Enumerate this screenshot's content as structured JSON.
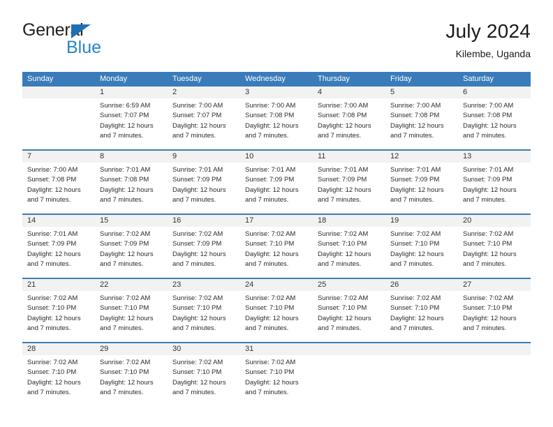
{
  "brand": {
    "name_top": "General",
    "name_bottom": "Blue",
    "triangle_color": "#1f6fb5",
    "top_color": "#231f20",
    "bottom_color": "#2585c7"
  },
  "header": {
    "title": "July 2024",
    "subtitle": "Kilembe, Uganda"
  },
  "theme": {
    "header_blue": "#3a7cba",
    "day_band_gray": "#f2f2f2",
    "text": "#2b2b2b"
  },
  "weekdays": [
    "Sunday",
    "Monday",
    "Tuesday",
    "Wednesday",
    "Thursday",
    "Friday",
    "Saturday"
  ],
  "weeks": [
    [
      {
        "day": "",
        "lines": []
      },
      {
        "day": "1",
        "lines": [
          "Sunrise: 6:59 AM",
          "Sunset: 7:07 PM",
          "Daylight: 12 hours",
          "and 7 minutes."
        ]
      },
      {
        "day": "2",
        "lines": [
          "Sunrise: 7:00 AM",
          "Sunset: 7:07 PM",
          "Daylight: 12 hours",
          "and 7 minutes."
        ]
      },
      {
        "day": "3",
        "lines": [
          "Sunrise: 7:00 AM",
          "Sunset: 7:08 PM",
          "Daylight: 12 hours",
          "and 7 minutes."
        ]
      },
      {
        "day": "4",
        "lines": [
          "Sunrise: 7:00 AM",
          "Sunset: 7:08 PM",
          "Daylight: 12 hours",
          "and 7 minutes."
        ]
      },
      {
        "day": "5",
        "lines": [
          "Sunrise: 7:00 AM",
          "Sunset: 7:08 PM",
          "Daylight: 12 hours",
          "and 7 minutes."
        ]
      },
      {
        "day": "6",
        "lines": [
          "Sunrise: 7:00 AM",
          "Sunset: 7:08 PM",
          "Daylight: 12 hours",
          "and 7 minutes."
        ]
      }
    ],
    [
      {
        "day": "7",
        "lines": [
          "Sunrise: 7:00 AM",
          "Sunset: 7:08 PM",
          "Daylight: 12 hours",
          "and 7 minutes."
        ]
      },
      {
        "day": "8",
        "lines": [
          "Sunrise: 7:01 AM",
          "Sunset: 7:08 PM",
          "Daylight: 12 hours",
          "and 7 minutes."
        ]
      },
      {
        "day": "9",
        "lines": [
          "Sunrise: 7:01 AM",
          "Sunset: 7:09 PM",
          "Daylight: 12 hours",
          "and 7 minutes."
        ]
      },
      {
        "day": "10",
        "lines": [
          "Sunrise: 7:01 AM",
          "Sunset: 7:09 PM",
          "Daylight: 12 hours",
          "and 7 minutes."
        ]
      },
      {
        "day": "11",
        "lines": [
          "Sunrise: 7:01 AM",
          "Sunset: 7:09 PM",
          "Daylight: 12 hours",
          "and 7 minutes."
        ]
      },
      {
        "day": "12",
        "lines": [
          "Sunrise: 7:01 AM",
          "Sunset: 7:09 PM",
          "Daylight: 12 hours",
          "and 7 minutes."
        ]
      },
      {
        "day": "13",
        "lines": [
          "Sunrise: 7:01 AM",
          "Sunset: 7:09 PM",
          "Daylight: 12 hours",
          "and 7 minutes."
        ]
      }
    ],
    [
      {
        "day": "14",
        "lines": [
          "Sunrise: 7:01 AM",
          "Sunset: 7:09 PM",
          "Daylight: 12 hours",
          "and 7 minutes."
        ]
      },
      {
        "day": "15",
        "lines": [
          "Sunrise: 7:02 AM",
          "Sunset: 7:09 PM",
          "Daylight: 12 hours",
          "and 7 minutes."
        ]
      },
      {
        "day": "16",
        "lines": [
          "Sunrise: 7:02 AM",
          "Sunset: 7:09 PM",
          "Daylight: 12 hours",
          "and 7 minutes."
        ]
      },
      {
        "day": "17",
        "lines": [
          "Sunrise: 7:02 AM",
          "Sunset: 7:10 PM",
          "Daylight: 12 hours",
          "and 7 minutes."
        ]
      },
      {
        "day": "18",
        "lines": [
          "Sunrise: 7:02 AM",
          "Sunset: 7:10 PM",
          "Daylight: 12 hours",
          "and 7 minutes."
        ]
      },
      {
        "day": "19",
        "lines": [
          "Sunrise: 7:02 AM",
          "Sunset: 7:10 PM",
          "Daylight: 12 hours",
          "and 7 minutes."
        ]
      },
      {
        "day": "20",
        "lines": [
          "Sunrise: 7:02 AM",
          "Sunset: 7:10 PM",
          "Daylight: 12 hours",
          "and 7 minutes."
        ]
      }
    ],
    [
      {
        "day": "21",
        "lines": [
          "Sunrise: 7:02 AM",
          "Sunset: 7:10 PM",
          "Daylight: 12 hours",
          "and 7 minutes."
        ]
      },
      {
        "day": "22",
        "lines": [
          "Sunrise: 7:02 AM",
          "Sunset: 7:10 PM",
          "Daylight: 12 hours",
          "and 7 minutes."
        ]
      },
      {
        "day": "23",
        "lines": [
          "Sunrise: 7:02 AM",
          "Sunset: 7:10 PM",
          "Daylight: 12 hours",
          "and 7 minutes."
        ]
      },
      {
        "day": "24",
        "lines": [
          "Sunrise: 7:02 AM",
          "Sunset: 7:10 PM",
          "Daylight: 12 hours",
          "and 7 minutes."
        ]
      },
      {
        "day": "25",
        "lines": [
          "Sunrise: 7:02 AM",
          "Sunset: 7:10 PM",
          "Daylight: 12 hours",
          "and 7 minutes."
        ]
      },
      {
        "day": "26",
        "lines": [
          "Sunrise: 7:02 AM",
          "Sunset: 7:10 PM",
          "Daylight: 12 hours",
          "and 7 minutes."
        ]
      },
      {
        "day": "27",
        "lines": [
          "Sunrise: 7:02 AM",
          "Sunset: 7:10 PM",
          "Daylight: 12 hours",
          "and 7 minutes."
        ]
      }
    ],
    [
      {
        "day": "28",
        "lines": [
          "Sunrise: 7:02 AM",
          "Sunset: 7:10 PM",
          "Daylight: 12 hours",
          "and 7 minutes."
        ]
      },
      {
        "day": "29",
        "lines": [
          "Sunrise: 7:02 AM",
          "Sunset: 7:10 PM",
          "Daylight: 12 hours",
          "and 7 minutes."
        ]
      },
      {
        "day": "30",
        "lines": [
          "Sunrise: 7:02 AM",
          "Sunset: 7:10 PM",
          "Daylight: 12 hours",
          "and 7 minutes."
        ]
      },
      {
        "day": "31",
        "lines": [
          "Sunrise: 7:02 AM",
          "Sunset: 7:10 PM",
          "Daylight: 12 hours",
          "and 7 minutes."
        ]
      },
      {
        "day": "",
        "lines": []
      },
      {
        "day": "",
        "lines": []
      },
      {
        "day": "",
        "lines": []
      }
    ]
  ]
}
